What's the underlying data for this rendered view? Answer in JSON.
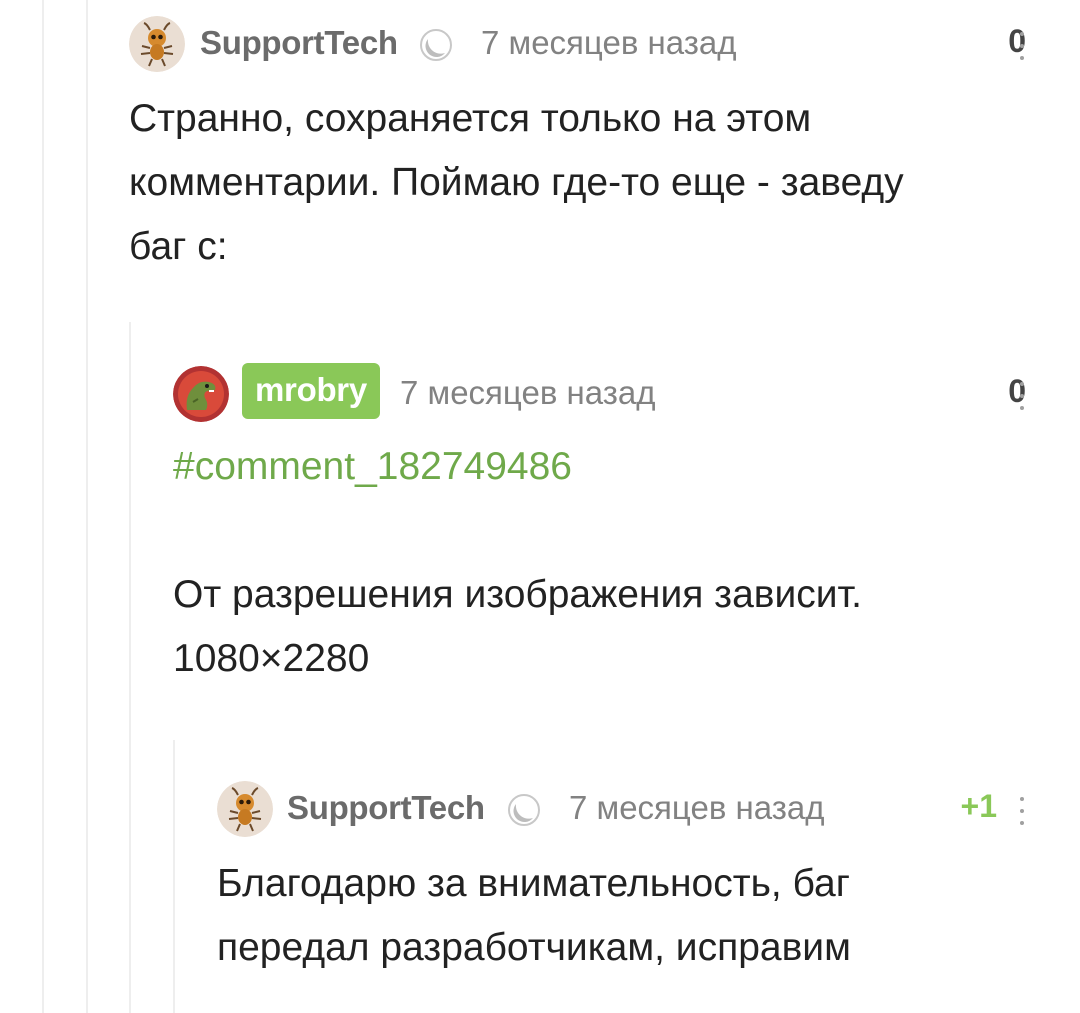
{
  "comments": [
    {
      "author": "SupportTech",
      "time": "7 месяцев назад",
      "rating": "0",
      "text_lines": [
        "Странно, сохраняется только на этом",
        "комментарии. Поймаю где-то еще - заведу",
        "баг с:"
      ],
      "badge_icon": "moon-badge-icon",
      "avatar_icon": "ant-mascot-icon"
    },
    {
      "author": "mrobry",
      "time": "7 месяцев назад",
      "rating": "0",
      "link": "#comment_182749486",
      "text_lines": [
        "От разрешения изображения зависит.",
        "1080×2280"
      ],
      "avatar_icon": "dinosaur-avatar-icon"
    },
    {
      "author": "SupportTech",
      "time": "7 месяцев назад",
      "rating": "+1",
      "text_lines": [
        "Благодарю за внимательность, баг",
        "передал разработчикам, исправим"
      ],
      "badge_icon": "moon-badge-icon",
      "avatar_icon": "ant-mascot-icon"
    }
  ],
  "colors": {
    "accent_green": "#8ac858",
    "link_green": "#6fa94a",
    "meta_gray": "#828282",
    "thread_line": "#eeeeee"
  }
}
